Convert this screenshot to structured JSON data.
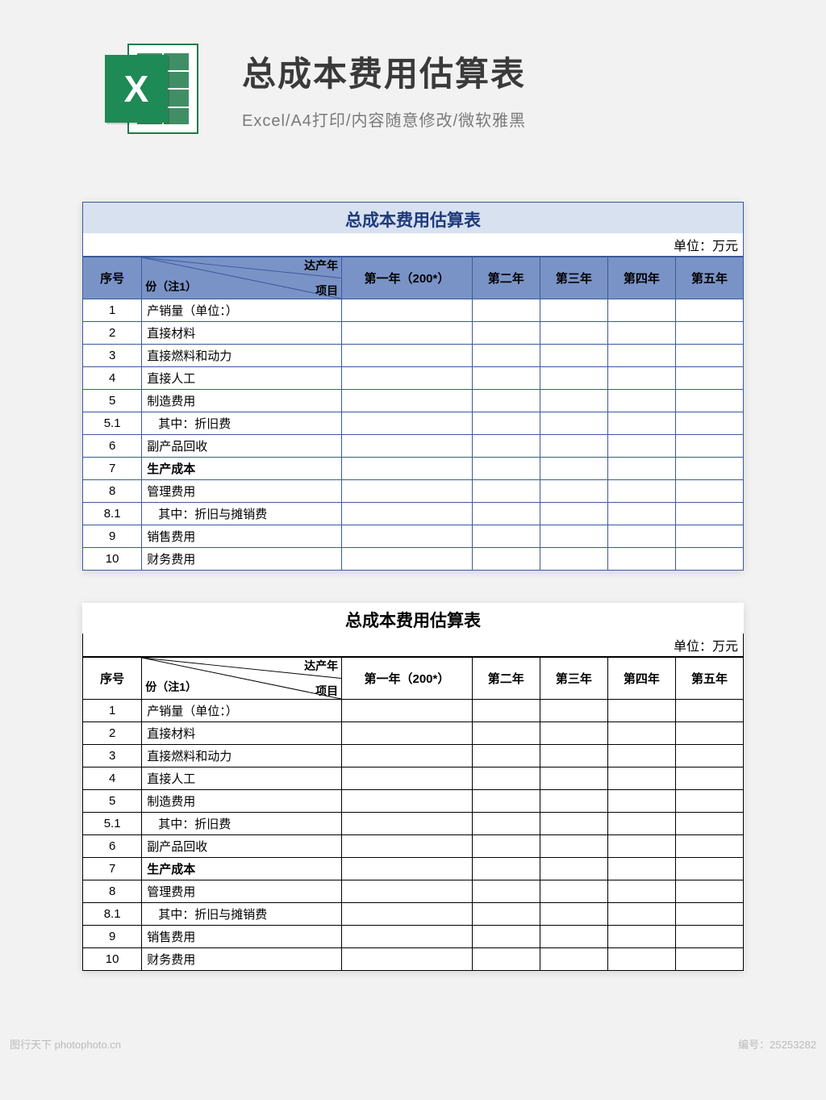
{
  "header": {
    "title": "总成本费用估算表",
    "subtitle": "Excel/A4打印/内容随意修改/微软雅黑",
    "icon_letter": "X"
  },
  "table": {
    "title": "总成本费用估算表",
    "unit": "单位：万元",
    "head": {
      "seq": "序号",
      "diag_top": "达产年",
      "diag_mid": "份（注1）",
      "diag_bottom": "项目",
      "y1": "第一年（200*）",
      "y2": "第二年",
      "y3": "第三年",
      "y4": "第四年",
      "y5": "第五年"
    },
    "rows": [
      {
        "seq": "1",
        "item": "产销量（单位：）",
        "bold": false,
        "indent": false
      },
      {
        "seq": "2",
        "item": "直接材料",
        "bold": false,
        "indent": false
      },
      {
        "seq": "3",
        "item": "直接燃料和动力",
        "bold": false,
        "indent": false
      },
      {
        "seq": "4",
        "item": "直接人工",
        "bold": false,
        "indent": false
      },
      {
        "seq": "5",
        "item": "制造费用",
        "bold": false,
        "indent": false
      },
      {
        "seq": "5.1",
        "item": "其中：折旧费",
        "bold": false,
        "indent": true
      },
      {
        "seq": "6",
        "item": "副产品回收",
        "bold": false,
        "indent": false
      },
      {
        "seq": "7",
        "item": "生产成本",
        "bold": true,
        "indent": false
      },
      {
        "seq": "8",
        "item": "管理费用",
        "bold": false,
        "indent": false
      },
      {
        "seq": "8.1",
        "item": "其中：折旧与摊销费",
        "bold": false,
        "indent": true
      },
      {
        "seq": "9",
        "item": "销售费用",
        "bold": false,
        "indent": false
      },
      {
        "seq": "10",
        "item": "财务费用",
        "bold": false,
        "indent": false
      }
    ]
  },
  "watermark": {
    "left": "图行天下 photophoto.cn",
    "right": "编号：25253282"
  }
}
